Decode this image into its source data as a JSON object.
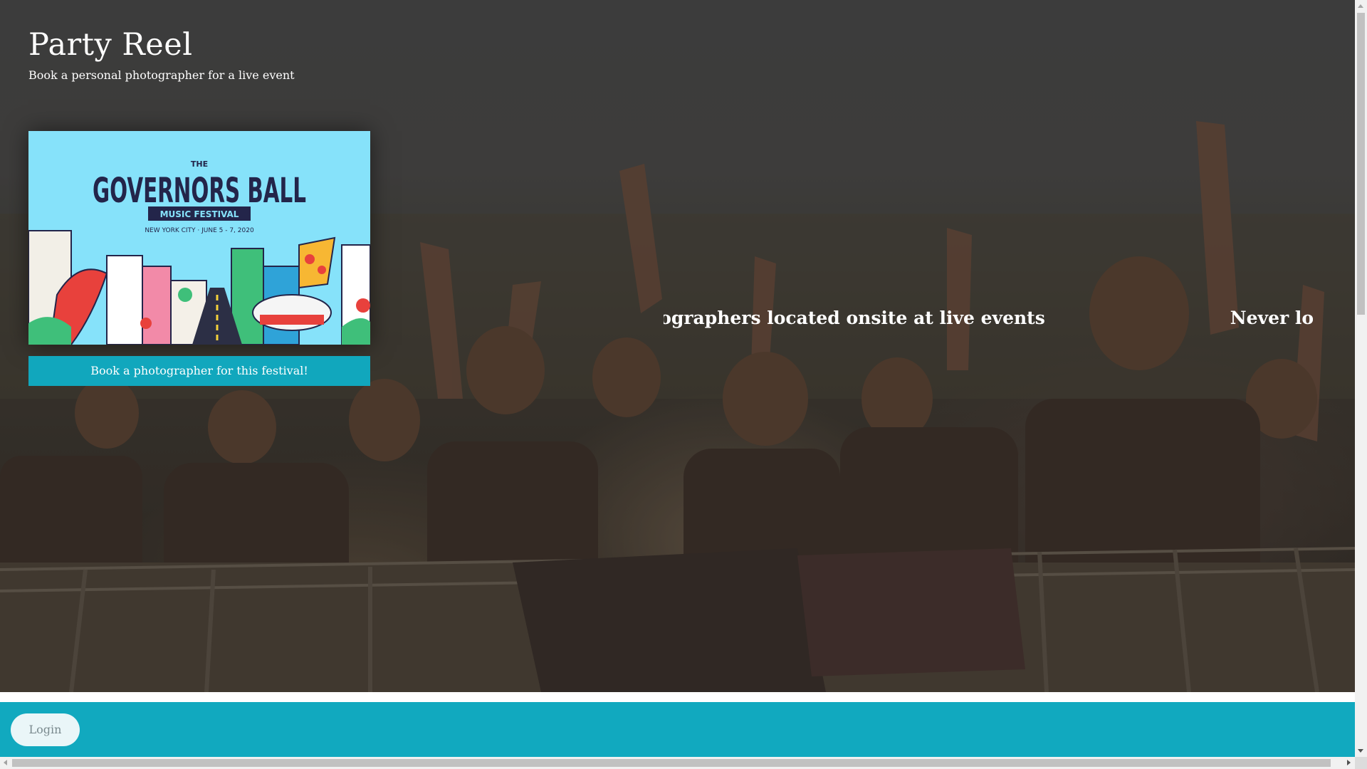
{
  "site": {
    "title": "Party Reel",
    "tagline": "Book a personal photographer for a live event"
  },
  "festival": {
    "poster_name": "governors-ball-poster",
    "poster_text_the": "THE",
    "poster_text_name": "GOVERNORS BALL",
    "poster_text_sub": "MUSIC FESTIVAL",
    "poster_text_date": "NEW YORK CITY · JUNE 5 - 7, 2020",
    "book_button_label": "Book a photographer for this festival!"
  },
  "marquee": {
    "items": [
      "otographers located onsite at live events",
      "Never lose batt"
    ]
  },
  "footer": {
    "login_label": "Login"
  },
  "colors": {
    "accent": "#11a7bd",
    "poster_bg": "#7fdbf5",
    "poster_ink": "#23254a",
    "login_bg": "#eaf6f8"
  },
  "icons": {
    "scroll_up": "triangle-up-icon",
    "scroll_down": "triangle-down-icon",
    "scroll_left": "triangle-left-icon",
    "scroll_right": "triangle-right-icon"
  }
}
